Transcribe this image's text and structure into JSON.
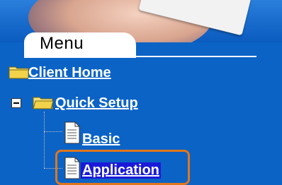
{
  "menu": {
    "tab_label": "Menu",
    "items": [
      {
        "label": "Client Home",
        "icon": "folder-icon"
      },
      {
        "label": "Quick Setup",
        "icon": "open-folder-icon",
        "expanded": true
      },
      {
        "label": "Basic",
        "icon": "document-icon"
      },
      {
        "label": "Application",
        "icon": "document-icon",
        "selected": true
      }
    ]
  },
  "colors": {
    "background": "#0b63c6",
    "highlight_border": "#e0761c",
    "selected_bg": "#1a1ad8"
  }
}
